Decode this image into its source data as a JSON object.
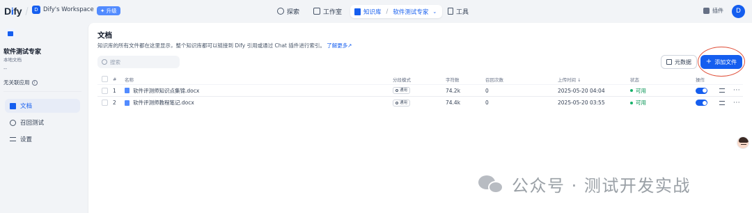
{
  "app": {
    "logo_text_pre": "D",
    "logo_text_i": "i",
    "logo_text_post": "fy",
    "workspace_initial": "D",
    "workspace_name": "Dify's Workspace",
    "workspace_caret": "⌄",
    "upgrade_label": "✦ 升级",
    "user_initial": "D",
    "plugin_label": "插件"
  },
  "nav": {
    "explore": "探索",
    "studio": "工作室",
    "knowledge": "知识库",
    "current_kb": "软件测试专家",
    "tools": "工具"
  },
  "sidebar": {
    "kb_name": "软件测试专家",
    "kb_type": "本地文档",
    "kb_desc": "--",
    "linked_apps": "无关联应用",
    "items": [
      {
        "label": "文档"
      },
      {
        "label": "召回测试"
      },
      {
        "label": "设置"
      }
    ]
  },
  "main": {
    "title": "文档",
    "description": "知识库的所有文件都在这里显示，整个知识库都可以链接到 Dify 引用或通过 Chat 插件进行索引。",
    "learn_more": "了解更多↗",
    "search_placeholder": "搜索",
    "metadata_button": "元数据",
    "add_file_button": "添加文件"
  },
  "table": {
    "headers": {
      "index": "#",
      "name": "名称",
      "mode": "分段模式",
      "chars": "字符数",
      "hits": "召回次数",
      "upload_time": "上传时间 ↓",
      "status": "状态",
      "actions": "操作"
    },
    "rows": [
      {
        "index": "1",
        "name": "软件评测师知识点集锦.docx",
        "mode": "通用",
        "chars": "74.2k",
        "hits": "0",
        "upload_time": "2025-05-20 04:04",
        "status": "可用",
        "enabled": true
      },
      {
        "index": "2",
        "name": "软件评测师教程笔记.docx",
        "mode": "通用",
        "chars": "74.4k",
        "hits": "0",
        "upload_time": "2025-05-20 03:55",
        "status": "可用",
        "enabled": true
      }
    ]
  },
  "watermark": {
    "text": "公众号 · 测试开发实战"
  },
  "colors": {
    "primary": "#155eef",
    "status_ok": "#17b26a",
    "highlight": "#e0503a"
  }
}
